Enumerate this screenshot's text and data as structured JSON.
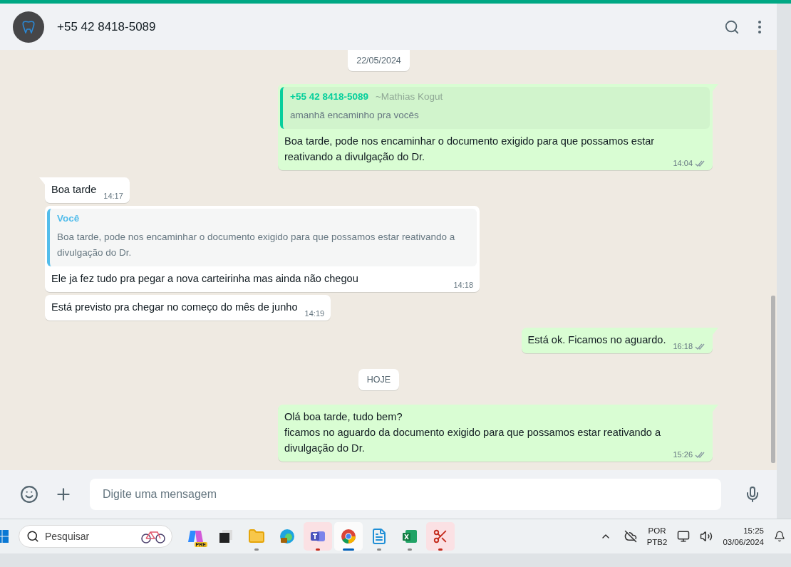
{
  "header": {
    "contact": "+55 42 8418-5089"
  },
  "messages": [
    {
      "kind": "date",
      "text": "22/05/2024"
    },
    {
      "kind": "out",
      "tail": true,
      "quote": {
        "author": "+55 42 8418-5089",
        "alias": "~Mathias Kogut",
        "text": "amanhã encaminho pra vocês",
        "color": "#06cf9c"
      },
      "text": "Boa tarde, pode nos encaminhar o documento exigido para que possamos estar reativando a divulgação do Dr.",
      "time": "14:04",
      "read": false
    },
    {
      "kind": "in",
      "tail": true,
      "text": "Boa tarde",
      "time": "14:17"
    },
    {
      "kind": "in",
      "tail": false,
      "quote": {
        "author": "Você",
        "text": "Boa tarde, pode nos encaminhar o documento exigido para que possamos estar reativando a divulgação do Dr.",
        "color": "#53bdeb"
      },
      "text": "Ele ja fez tudo pra pegar a nova carteirinha mas ainda não chegou",
      "time": "14:18"
    },
    {
      "kind": "in",
      "tail": false,
      "text": "Está previsto pra chegar no começo do mês de junho",
      "time": "14:19"
    },
    {
      "kind": "out",
      "tail": true,
      "text": "Está ok. Ficamos no aguardo.",
      "time": "16:18",
      "read": false
    },
    {
      "kind": "date",
      "text": "HOJE"
    },
    {
      "kind": "out",
      "tail": true,
      "text": "Olá boa tarde, tudo bem?\nficamos no aguardo da documento exigido para que possamos estar reativando a divulgação do Dr.",
      "time": "15:26",
      "read": false
    }
  ],
  "composer": {
    "placeholder": "Digite uma mensagem"
  },
  "taskbar": {
    "search_placeholder": "Pesquisar",
    "apps": [
      {
        "kind": "copilot",
        "badge": "PRE",
        "running": false,
        "selected": false,
        "attention": false
      },
      {
        "kind": "taskview",
        "running": false,
        "selected": false,
        "attention": false
      },
      {
        "kind": "explorer",
        "running": true,
        "selected": false,
        "attention": false
      },
      {
        "kind": "edge",
        "running": false,
        "selected": false,
        "attention": false
      },
      {
        "kind": "teams",
        "running": true,
        "selected": false,
        "attention": true
      },
      {
        "kind": "chrome",
        "running": true,
        "selected": true,
        "attention": false
      },
      {
        "kind": "notepad",
        "running": true,
        "selected": false,
        "attention": false
      },
      {
        "kind": "excel",
        "running": true,
        "selected": false,
        "attention": false
      },
      {
        "kind": "snipping",
        "running": true,
        "selected": false,
        "attention": true
      }
    ],
    "language": "POR",
    "layout": "PTB2",
    "time": "15:25",
    "date": "03/06/2024"
  }
}
